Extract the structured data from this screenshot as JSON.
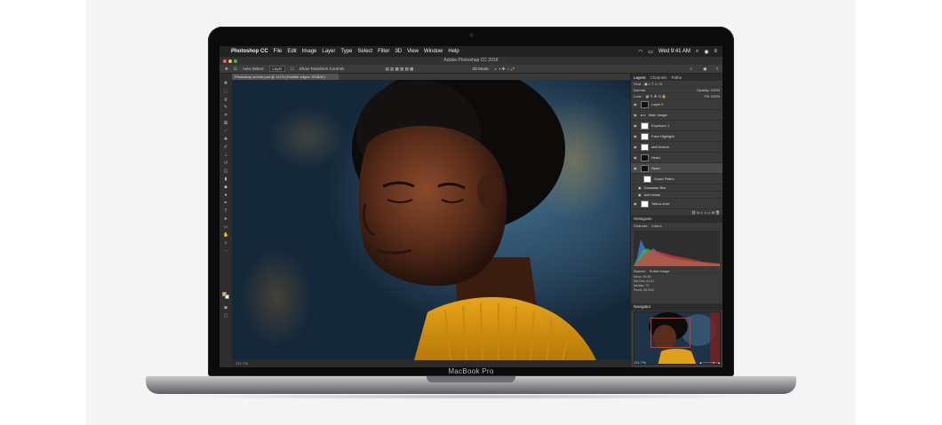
{
  "menubar": {
    "app_name": "Photoshop CC",
    "items": [
      "File",
      "Edit",
      "Image",
      "Layer",
      "Type",
      "Select",
      "Filter",
      "3D",
      "View",
      "Window",
      "Help"
    ],
    "clock": "Wed 9:41 AM"
  },
  "window_title": "Adobe Photoshop CC 2018",
  "options_bar": {
    "auto_select_label": "Auto-Select:",
    "auto_select_value": "Layer",
    "transform_label": "Show Transform Controls",
    "mode_label": "3D Mode:"
  },
  "document_tab": "Photoshop screen.psd @ 121% (Feather edges, RGB/8*)",
  "status_bar": "121.7%",
  "panels": {
    "tabs": [
      "Layers",
      "Channels",
      "Paths"
    ],
    "kind_label": "Kind",
    "blend_mode": "Normal",
    "opacity": "Opacity: 100%",
    "lock_label": "Lock:",
    "fill": "Fill: 100%",
    "layers": [
      {
        "name": "Layer 0"
      },
      {
        "name": "Main Image"
      },
      {
        "name": "Exposure 1"
      },
      {
        "name": "Face Highlight"
      },
      {
        "name": "skill texture"
      },
      {
        "name": "Head"
      },
      {
        "name": "Head"
      },
      {
        "name": "Smart Filters"
      },
      {
        "name": "Gaussian Blur"
      },
      {
        "name": "Add Noise"
      },
      {
        "name": "Yellow shirt"
      }
    ],
    "histogram_title": "Histogram",
    "histogram_channel_label": "Channel:",
    "histogram_channel": "Colors",
    "histogram_source_label": "Source:",
    "histogram_source": "Entire Image",
    "histogram_stats": [
      "Mean: 84.60",
      "Std Dev: 61.81",
      "Median: 70",
      "Pixels: 567520"
    ],
    "navigator_title": "Navigator",
    "navigator_zoom": "121.7%"
  },
  "branding": "MacBook Pro"
}
